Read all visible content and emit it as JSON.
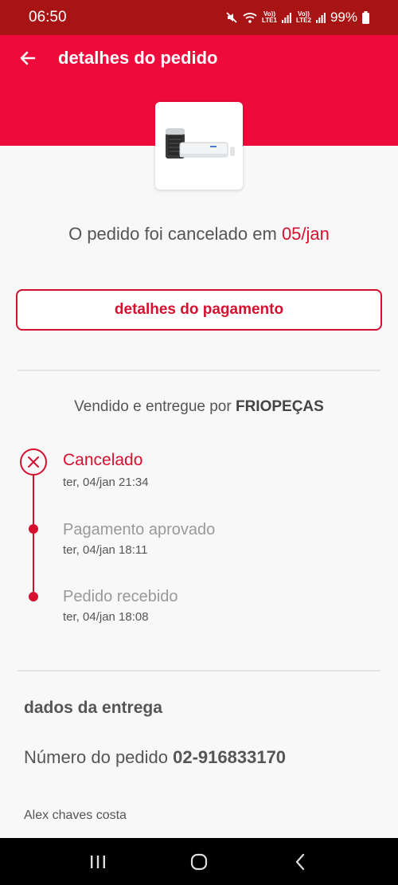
{
  "status_bar": {
    "time": "06:50",
    "battery": "99%",
    "sim1_label": "LTE1",
    "sim2_label": "LTE2",
    "volte_label": "Vo))"
  },
  "header": {
    "title": "detalhes do pedido",
    "color": "#ee0a3a"
  },
  "order": {
    "cancel_prefix": "O pedido foi cancelado em ",
    "cancel_date": "05/jan",
    "payment_button_label": "detalhes do pagamento",
    "seller_prefix": "Vendido e entregue por ",
    "seller_name": "FRIOPEÇAS"
  },
  "timeline": [
    {
      "title": "Cancelado",
      "time": "ter, 04/jan 21:34"
    },
    {
      "title": "Pagamento aprovado",
      "time": "ter, 04/jan 18:11"
    },
    {
      "title": "Pedido recebido",
      "time": "ter, 04/jan 18:08"
    }
  ],
  "delivery": {
    "section_title": "dados da entrega",
    "order_number_label": "Número do pedido ",
    "order_number": "02-916833170",
    "recipient": "Alex chaves costa"
  },
  "icons": {
    "back": "arrow-left-icon",
    "cancel": "x-circle-icon",
    "nav_recents": "recents-icon",
    "nav_home": "home-icon",
    "nav_back": "chevron-left-icon"
  },
  "accent_color": "#d6102f"
}
